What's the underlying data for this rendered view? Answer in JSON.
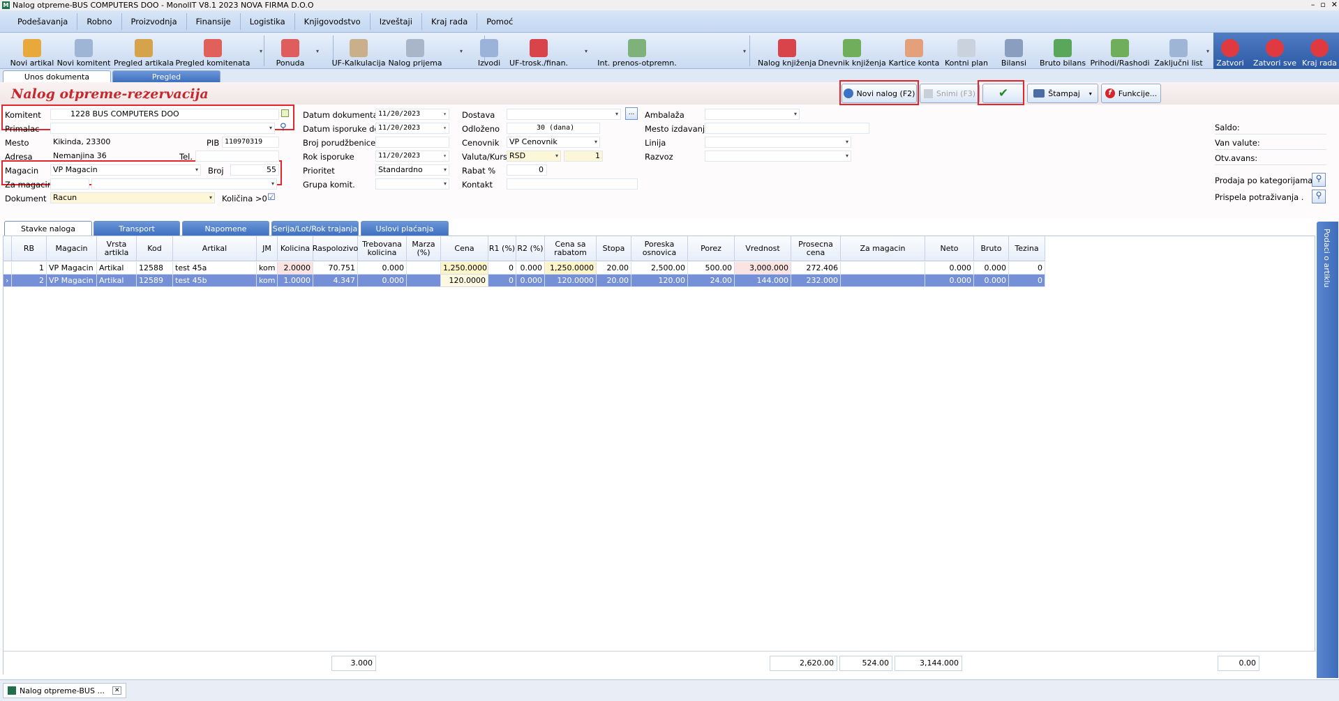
{
  "window": {
    "title": "Nalog otpreme-BUS COMPUTERS DOO - MonolIT V8.1 2023 NOVA FIRMA D.O.O",
    "controls": [
      "–",
      "▫",
      "✕"
    ]
  },
  "menu": [
    "Podešavanja",
    "Robno",
    "Proizvodnja",
    "Finansije",
    "Logistika",
    "Knjigovodstvo",
    "Izveštaji",
    "Kraj rada",
    "Pomoć"
  ],
  "toolbar": [
    {
      "label": "Novi artikal",
      "icon": "box-icon",
      "color": "#e8a93a"
    },
    {
      "label": "Novi komitent",
      "icon": "user-add-icon",
      "color": "#9fb5d6"
    },
    {
      "label": "Pregled artikala",
      "icon": "articles-icon",
      "color": "#d6a24a"
    },
    {
      "label": "Pregled komitenata",
      "icon": "partners-icon",
      "color": "#e0605a"
    },
    {
      "label": "Ponuda",
      "icon": "offer-icon",
      "color": "#e05d5d"
    },
    {
      "label": "UF-Kalkulacija",
      "icon": "calc-icon",
      "color": "#c9b08a"
    },
    {
      "label": "Nalog prijema",
      "icon": "receipt-icon",
      "color": "#a9b6c9"
    },
    {
      "label": "Izvodi",
      "icon": "statement-icon",
      "color": "#9bb3d8"
    },
    {
      "label": "UF-trosk./finan.",
      "icon": "cost-icon",
      "color": "#d9434a"
    },
    {
      "label": "Int. prenos-otpremn.",
      "icon": "transfer-icon",
      "color": "#7fb27a"
    },
    {
      "label": "Nalog knjiženja",
      "icon": "book-icon",
      "color": "#d9434a"
    },
    {
      "label": "Dnevnik knjiženja",
      "icon": "journal-icon",
      "color": "#6fae5a"
    },
    {
      "label": "Kartice konta",
      "icon": "cards-icon",
      "color": "#e3a07a"
    },
    {
      "label": "Kontni plan",
      "icon": "plan-icon",
      "color": "#c9d2dd"
    },
    {
      "label": "Bilansi",
      "icon": "balance-icon",
      "color": "#8a9fc0"
    },
    {
      "label": "Bruto bilans",
      "icon": "pie-icon",
      "color": "#5aa65a"
    },
    {
      "label": "Prihodi/Rashodi",
      "icon": "income-icon",
      "color": "#6fae5a"
    },
    {
      "label": "Zaključni list",
      "icon": "sheet-icon",
      "color": "#9fb5d6"
    }
  ],
  "toolbar_right": [
    {
      "label": "Zatvori",
      "icon": "close-x-icon",
      "color": "#e0393f"
    },
    {
      "label": "Zatvori sve",
      "icon": "close-all-icon",
      "color": "#e0393f"
    },
    {
      "label": "Kraj rada",
      "icon": "power-icon",
      "color": "#e0393f"
    }
  ],
  "doc_tabs": [
    "Unos dokumenta",
    "Pregled"
  ],
  "form_title": "Nalog otpreme-rezervacija",
  "actions": {
    "new_order": "Novi nalog (F2)",
    "save": "Snimi (F3)",
    "confirm": "✔",
    "print": "Štampaj",
    "functions": "Funkcije..."
  },
  "fields": {
    "komitent_label": "Komitent",
    "komitent": "1228 BUS COMPUTERS DOO",
    "primalac_label": "Primalac",
    "primalac": "",
    "mesto_label": "Mesto",
    "mesto": "Kikinda, 23300",
    "pib_label": "PIB",
    "pib": "110970319",
    "adresa_label": "Adresa",
    "adresa": "Nemanjina 36",
    "tel_label": "Tel.",
    "tel": "",
    "magacin_label": "Magacin",
    "magacin": "VP Magacin",
    "broj_label": "Broj",
    "broj": "55",
    "za_magacin_label": "Za magacin",
    "za_magacin": "",
    "dokument_label": "Dokument",
    "dokument": "Racun",
    "kolicina_label": "Količina >0",
    "kolicina_checked": "☑",
    "datum_dok_label": "Datum dokumenta",
    "datum_dok": "11/20/2023",
    "datum_isp_label": "Datum isporuke do",
    "datum_isp": "11/20/2023",
    "broj_por_label": "Broj porudžbenice",
    "broj_por": "",
    "rok_label": "Rok isporuke",
    "rok": "11/20/2023",
    "prioritet_label": "Prioritet",
    "prioritet": "Standardno",
    "grupa_label": "Grupa komit.",
    "grupa": "",
    "dostava_label": "Dostava",
    "dostava": "",
    "odlozeno_label": "Odloženo",
    "odlozeno": "30 (dana)",
    "cenovnik_label": "Cenovnik",
    "cenovnik": "VP Cenovnik",
    "valuta_label": "Valuta/Kurs",
    "valuta": "RSD",
    "kurs": "1",
    "rabat_label": "Rabat %",
    "rabat": "0",
    "kontakt_label": "Kontakt",
    "kontakt": "",
    "ambalaza_label": "Ambalaža",
    "ambalaza": "",
    "mesto_izd_label": "Mesto izdavanja",
    "mesto_izd": "",
    "linija_label": "Linija",
    "linija": "",
    "razvoz_label": "Razvoz",
    "razvoz": ""
  },
  "summary": {
    "saldo": "Saldo:",
    "van_valute": "Van valute:",
    "otv_avans": "Otv.avans:",
    "prodaja": "Prodaja po kategorijama",
    "prispela": "Prispela potraživanja ."
  },
  "grid_tabs": [
    "Stavke naloga",
    "Transport",
    "Napomene",
    "Serija/Lot/Rok trajanja",
    "Uslovi plaćanja"
  ],
  "columns": [
    "",
    "RB",
    "Magacin",
    "Vrsta artikla",
    "Kod",
    "Artikal",
    "JM",
    "Kolicina",
    "Raspolozivo",
    "Trebovana kolicina",
    "Marza (%)",
    "Cena",
    "R1 (%)",
    "R2 (%)",
    "Cena sa rabatom",
    "Stopa",
    "Poreska osnovica",
    "Porez",
    "Vrednost",
    "Prosecna cena",
    "Za magacin",
    "Neto",
    "Bruto",
    "Tezina"
  ],
  "rows": [
    [
      "",
      "1",
      "VP Magacin",
      "Artikal",
      "12588",
      "test 45a",
      "kom",
      "2.0000",
      "70.751",
      "0.000",
      "",
      "1,250.0000",
      "0",
      "0.000",
      "1,250.0000",
      "20.00",
      "2,500.00",
      "500.00",
      "3,000.000",
      "272.406",
      "",
      "0.000",
      "0.000",
      "0"
    ],
    [
      "›",
      "2",
      "VP Magacin",
      "Artikal",
      "12589",
      "test 45b",
      "kom",
      "1.0000",
      "4.347",
      "0.000",
      "",
      "120.0000",
      "0",
      "0.000",
      "120.0000",
      "20.00",
      "120.00",
      "24.00",
      "144.000",
      "232.000",
      "",
      "0.000",
      "0.000",
      "0"
    ]
  ],
  "totals": {
    "kolicina": "3.000",
    "osnovica": "2,620.00",
    "porez": "524.00",
    "vrednost": "3,144.000",
    "tezina": "0.00"
  },
  "side_panel": "Podaci o artiklu",
  "bottom_tab": "Nalog otpreme-BUS ...",
  "bottom_tab_close": "✕"
}
